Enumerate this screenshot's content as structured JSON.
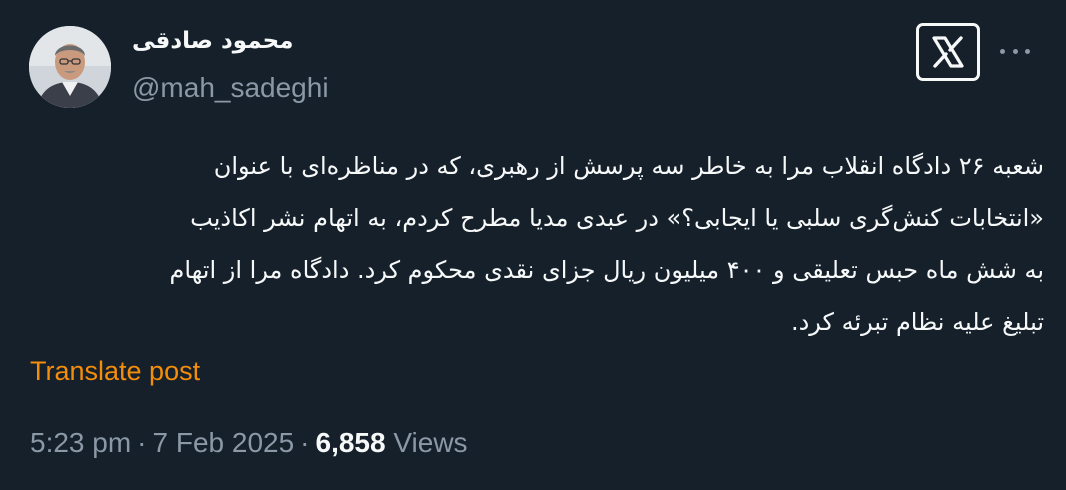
{
  "author": {
    "display_name": "محمود صادقی",
    "handle": "@mah_sadeghi"
  },
  "icons": {
    "logo": "x-logo-icon",
    "more": "more-options-icon"
  },
  "post": {
    "lines": [
      "شعبه ۲۶ دادگاه انقلاب مرا به خاطر سه پرسش از رهبری، که در مناظره‌ای با عنوان",
      "«انتخابات کنش‌گری سلبی یا ایجابی؟» در عبدی مدیا مطرح کردم، به اتهام نشر اکاذیب",
      "به شش ماه حبس تعلیقی و ۴۰۰ میلیون ریال جزای نقدی محکوم کرد. دادگاه مرا از اتهام",
      "تبلیغ علیه نظام تبرئه کرد."
    ],
    "translate_label": "Translate post"
  },
  "meta": {
    "time": "5:23 pm",
    "separator": "·",
    "date": "7 Feb 2025",
    "views_count": "6,858",
    "views_label": "Views"
  },
  "colors": {
    "background": "#15202b",
    "primary_text": "#f7f9f9",
    "secondary_text": "#8b98a5",
    "translate_link": "#f48d0a"
  }
}
